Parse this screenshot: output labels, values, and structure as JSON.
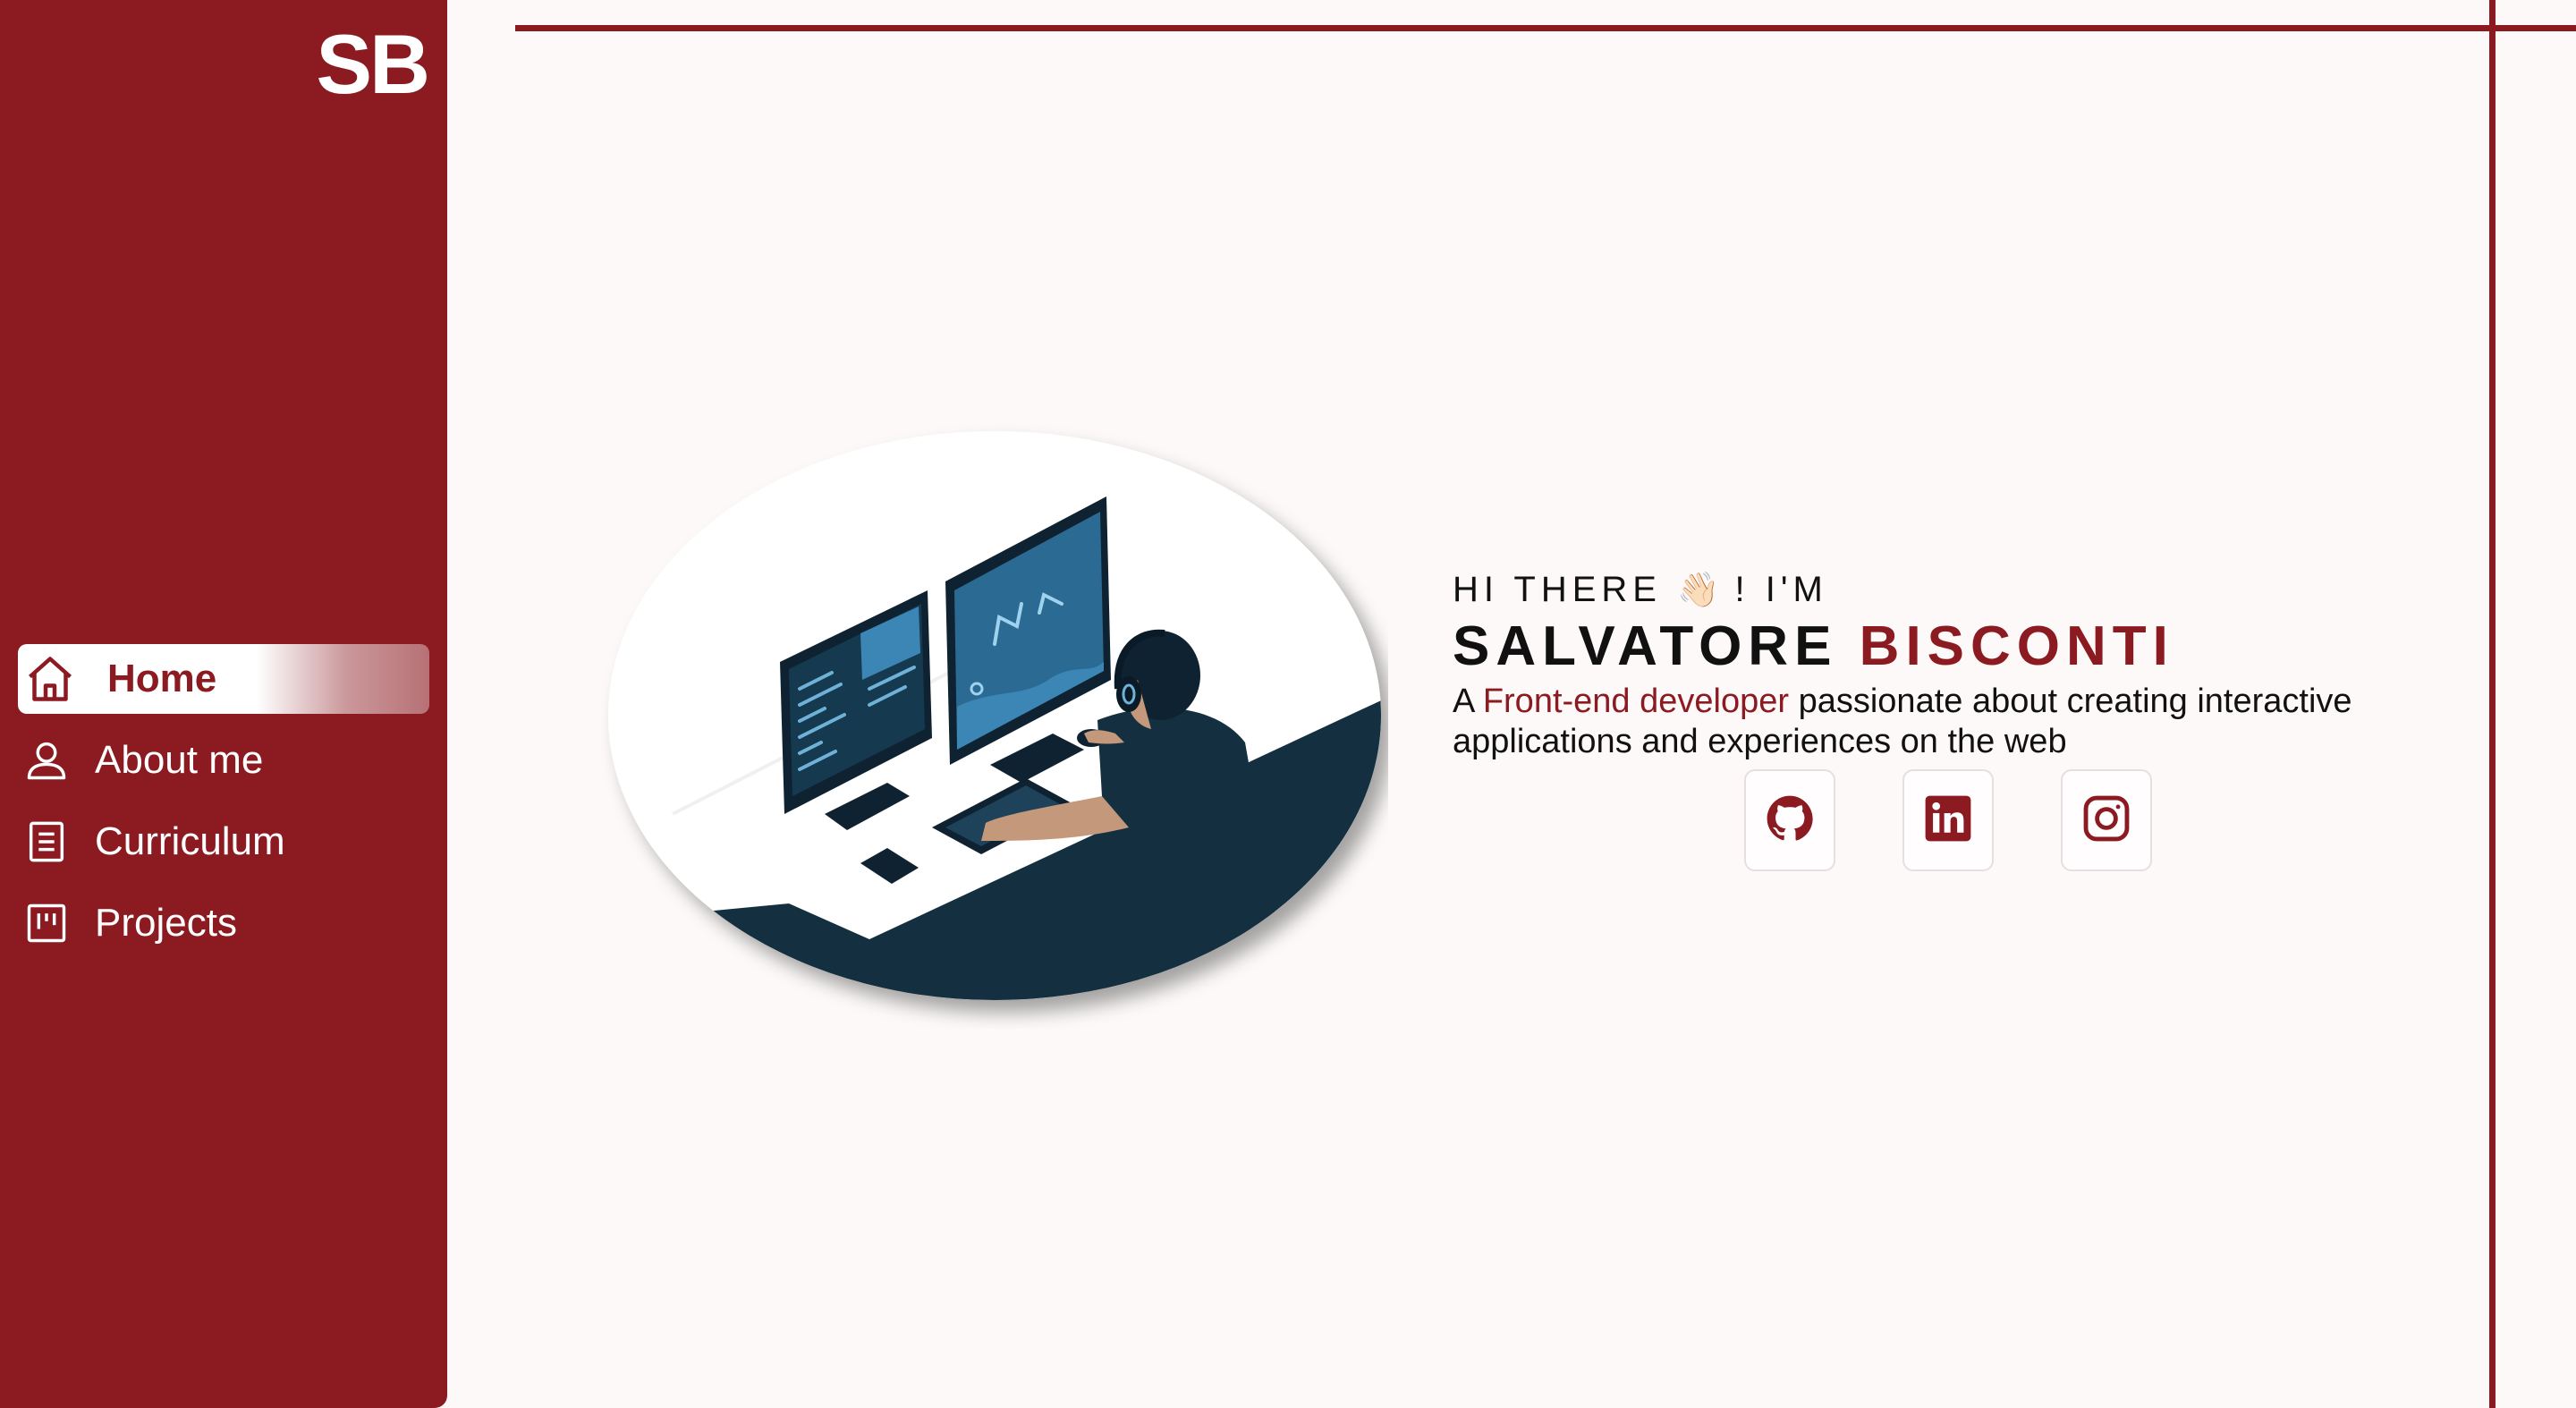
{
  "sidebar": {
    "logo": "SB",
    "items": [
      {
        "label": "Home",
        "icon": "home-icon",
        "active": true
      },
      {
        "label": "About me",
        "icon": "user-icon",
        "active": false
      },
      {
        "label": "Curriculum",
        "icon": "document-icon",
        "active": false
      },
      {
        "label": "Projects",
        "icon": "board-icon",
        "active": false
      }
    ]
  },
  "intro": {
    "greeting_before": "HI THERE ",
    "greeting_emoji": "👋🏻",
    "greeting_after": " ! I'M",
    "first_name": "SALVATORE",
    "last_name": "BISCONTI",
    "tagline_prefix": "A ",
    "tagline_accent": "Front-end developer",
    "tagline_rest": " passionate about creating interactive applications and experiences on the web"
  },
  "socials": [
    {
      "icon": "github-icon"
    },
    {
      "icon": "linkedin-icon"
    },
    {
      "icon": "instagram-icon"
    }
  ],
  "colors": {
    "brand": "#8b1a21",
    "background": "#fcf9f8",
    "illustration_dark": "#143040",
    "illustration_screen": "#3b86b4"
  }
}
